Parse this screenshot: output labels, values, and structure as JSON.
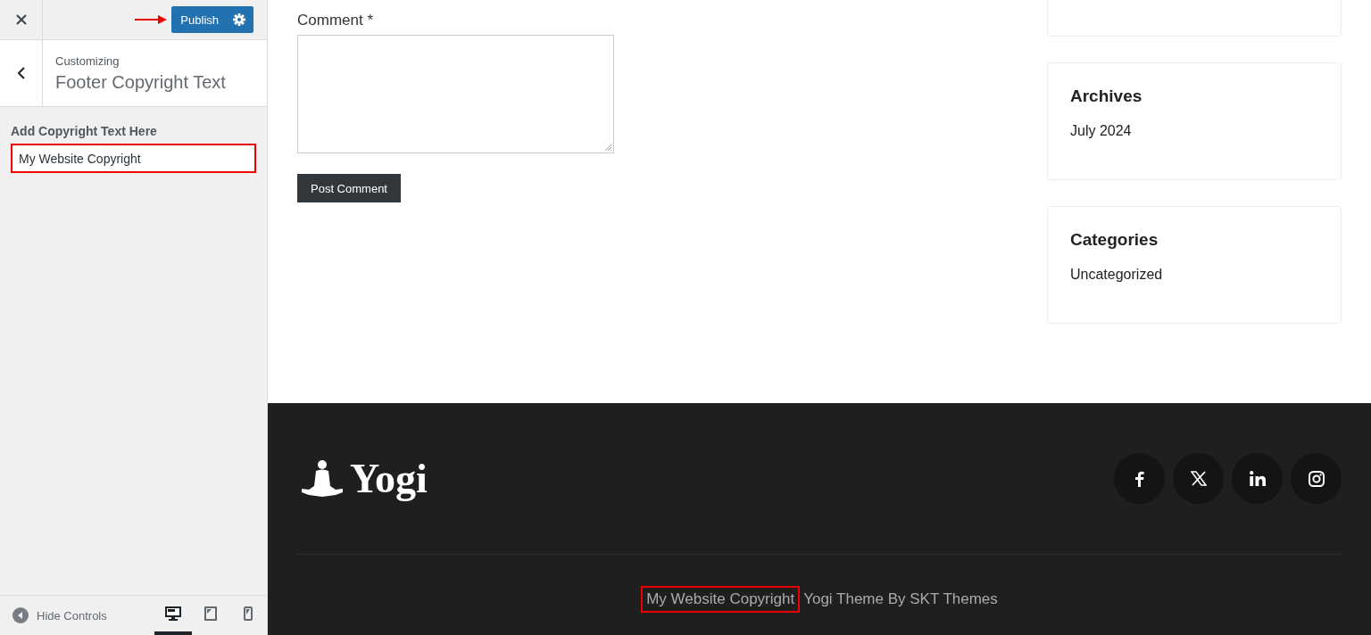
{
  "customizer": {
    "publish_label": "Publish",
    "breadcrumb": "Customizing",
    "section_title": "Footer Copyright Text",
    "field_label": "Add Copyright Text Here",
    "field_value": "My Website Copyright",
    "hide_controls": "Hide Controls",
    "devices": [
      {
        "kind": "desktop",
        "selected": true
      },
      {
        "kind": "tablet",
        "selected": false
      },
      {
        "kind": "mobile",
        "selected": false
      }
    ]
  },
  "comment_form": {
    "label": "Comment *",
    "submit": "Post Comment"
  },
  "widgets": [
    {
      "title": "Archives",
      "items": [
        "July 2024"
      ]
    },
    {
      "title": "Categories",
      "items": [
        "Uncategorized"
      ]
    }
  ],
  "footer": {
    "logo_text": "Yogi",
    "social": [
      {
        "kind": "facebook"
      },
      {
        "kind": "x"
      },
      {
        "kind": "linkedin"
      },
      {
        "kind": "instagram"
      }
    ],
    "copyright": "My Website Copyright",
    "credit": "Yogi Theme By SKT Themes"
  }
}
